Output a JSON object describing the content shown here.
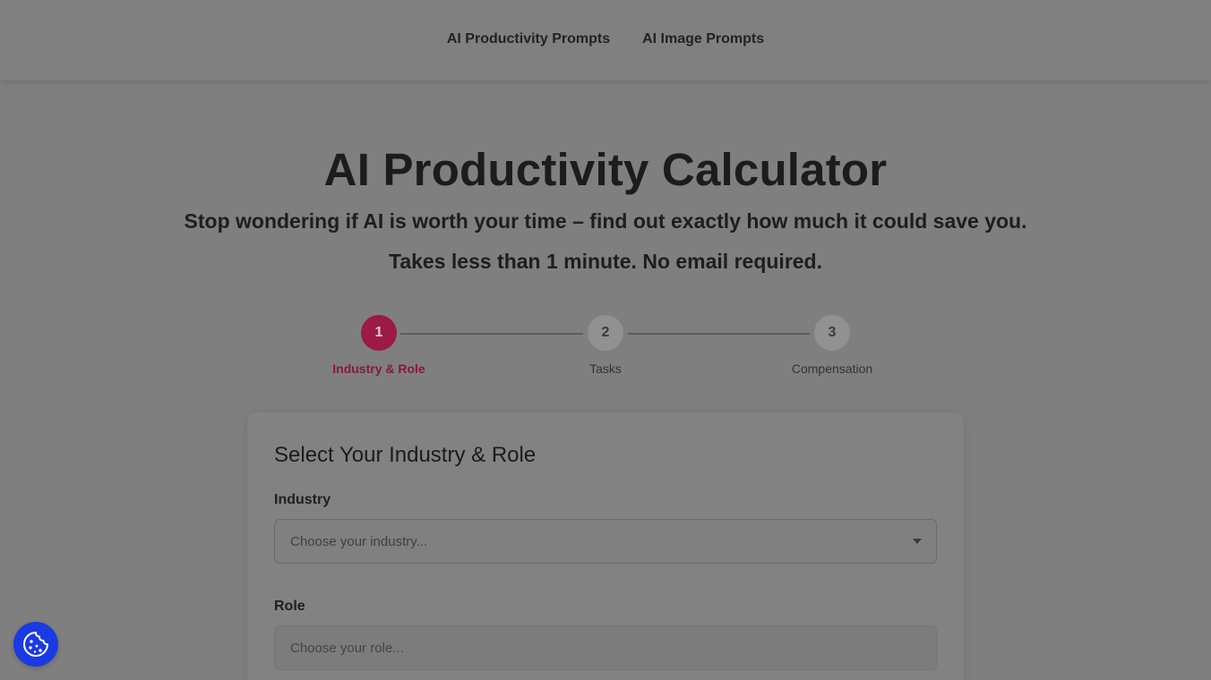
{
  "nav": {
    "links": [
      "AI Productivity Prompts",
      "AI Image Prompts"
    ]
  },
  "hero": {
    "title": "AI Productivity Calculator",
    "subtitle": "Stop wondering if AI is worth your time – find out exactly how much it could save you.",
    "note": "Takes less than 1 minute. No email required."
  },
  "stepper": {
    "current_step": 1,
    "steps": [
      {
        "number": "1",
        "label": "Industry & Role"
      },
      {
        "number": "2",
        "label": "Tasks"
      },
      {
        "number": "3",
        "label": "Compensation"
      }
    ]
  },
  "form": {
    "title": "Select Your Industry & Role",
    "industry": {
      "label": "Industry",
      "placeholder": "Choose your industry..."
    },
    "role": {
      "label": "Role",
      "placeholder": "Choose your role..."
    }
  },
  "cookie_button": {
    "icon": "cookie-icon"
  },
  "colors": {
    "accent": "#9b1a47",
    "overlay_background": "#7f7f7f",
    "cookie_button": "#1a3ae3"
  }
}
